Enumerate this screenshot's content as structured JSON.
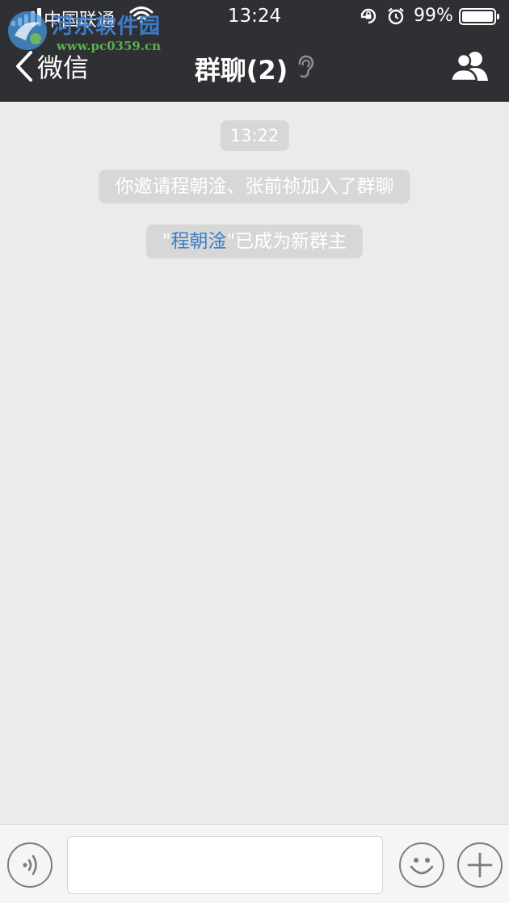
{
  "status_bar": {
    "carrier": "中国联通",
    "time": "13:24",
    "battery_percent": "99%"
  },
  "watermark": {
    "name": "河东软件园",
    "url": "www.pc0359.cn"
  },
  "nav": {
    "back_label": "微信",
    "title": "群聊(2)"
  },
  "chat": {
    "timestamp": "13:22",
    "messages": [
      {
        "text": "你邀请程朝淦、张前祯加入了群聊"
      },
      {
        "quote_open": "\"",
        "link": "程朝淦",
        "quote_close": "\"",
        "suffix": "已成为新群主"
      }
    ]
  },
  "colors": {
    "nav_bg": "#2e3034",
    "chat_bg": "#ebebeb",
    "pill_bg": "#d7d7d7",
    "link": "#3d7ec7"
  },
  "icons": {
    "back": "chevron-left-icon",
    "ear": "ear-icon",
    "members": "group-members-icon",
    "voice": "voice-input-icon",
    "emoji": "emoji-icon",
    "plus": "plus-icon"
  }
}
